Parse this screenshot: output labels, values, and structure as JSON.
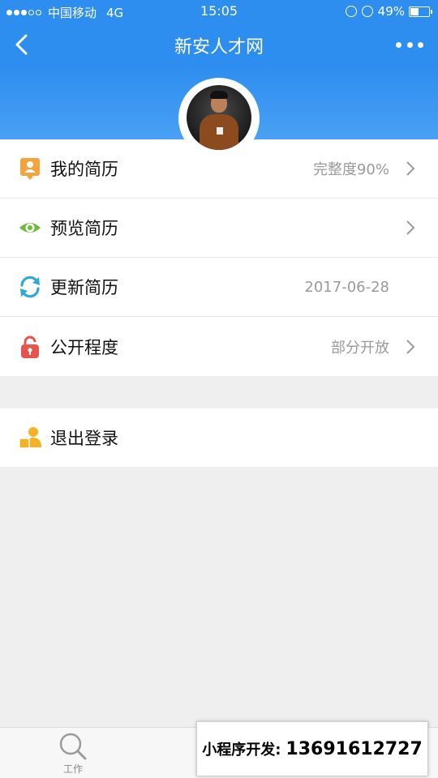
{
  "status_bar": {
    "carrier": "中国移动",
    "network": "4G",
    "time": "15:05",
    "battery_text": "49%",
    "battery_level": 0.49
  },
  "nav": {
    "title": "新安人才网",
    "back_icon": "back-arrow-icon",
    "more_icon": "more-dots-icon"
  },
  "menu": [
    {
      "label": "我的简历",
      "value": "完整度90%",
      "icon": "resume-person-icon",
      "color": "#f5a33a",
      "chevron": true
    },
    {
      "label": "预览简历",
      "value": "",
      "icon": "eye-icon",
      "color": "#6dbb3a",
      "chevron": true
    },
    {
      "label": "更新简历",
      "value": "2017-06-28",
      "icon": "refresh-icon",
      "color": "#2fa9d6",
      "chevron": false
    },
    {
      "label": "公开程度",
      "value": "部分开放",
      "icon": "unlock-icon",
      "color": "#e5544d",
      "chevron": true
    }
  ],
  "logout": {
    "label": "退出登录",
    "icon": "logout-user-icon",
    "color": "#f5b323"
  },
  "tab_bar": {
    "tabs": [
      {
        "label": "工作",
        "icon": "search-icon"
      }
    ]
  },
  "promo": {
    "label": "小程序开发:",
    "phone": "13691612727"
  },
  "colors": {
    "primary": "#2d8ef0",
    "background": "#efefef"
  }
}
